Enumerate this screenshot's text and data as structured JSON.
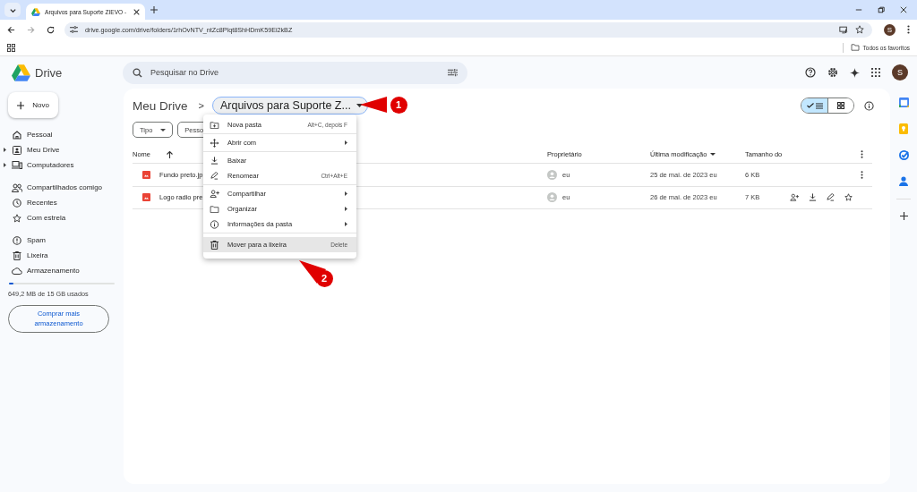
{
  "browser": {
    "tab_title": "Arquivos para Suporte ZIEVO -",
    "url": "drive.google.com/drive/folders/1rhOvNTV_ntZc8Plqt8ShHDmK59Ei2kBZ",
    "profile_initial": "S",
    "bookmarks_folder": "Todos os favoritos"
  },
  "app": {
    "logo_text": "Drive",
    "search": {
      "placeholder": "Pesquisar no Drive"
    },
    "account_initial": "S"
  },
  "new_button": "Novo",
  "sidebar": {
    "sections": [
      [
        {
          "label": "Pessoal",
          "expandable": false
        },
        {
          "label": "Meu Drive",
          "expandable": true
        },
        {
          "label": "Computadores",
          "expandable": true
        }
      ],
      [
        {
          "label": "Compartilhados comigo",
          "expandable": false
        },
        {
          "label": "Recentes",
          "expandable": false
        },
        {
          "label": "Com estrela",
          "expandable": false
        }
      ],
      [
        {
          "label": "Spam",
          "expandable": false
        },
        {
          "label": "Lixeira",
          "expandable": false
        },
        {
          "label": "Armazenamento",
          "expandable": false
        }
      ]
    ],
    "storage": {
      "level": 0.04,
      "text": "649,2 MB de 15 GB usados",
      "button": "Comprar mais armazenamento"
    }
  },
  "breadcrumb": {
    "root": "Meu Drive",
    "separator": ">",
    "current": "Arquivos para Suporte Z..."
  },
  "view_toggle": [
    {
      "selected": true
    },
    {
      "selected": false
    }
  ],
  "filters": [
    "Tipo",
    "Pesso"
  ],
  "table": {
    "columns": [
      "Nome",
      "Proprietário",
      "Última modificação",
      "Tamanho do"
    ],
    "rows": [
      {
        "name": "Fundo preto.jp",
        "owner": "eu",
        "modified": "25 de mai. de 2023 eu",
        "size": "6 KB",
        "hovered": false
      },
      {
        "name": "Logo radio pre",
        "owner": "eu",
        "modified": "26 de mai. de 2023 eu",
        "size": "7 KB",
        "hovered": true
      }
    ]
  },
  "context_menu": {
    "sections": [
      [
        {
          "label": "Nova pasta",
          "shortcut": "Alt+C, depois F",
          "submenu": false,
          "selected": false
        }
      ],
      [
        {
          "label": "Abrir com",
          "submenu": true,
          "selected": false
        }
      ],
      [
        {
          "label": "Baixar",
          "submenu": false,
          "selected": false
        },
        {
          "label": "Renomear",
          "shortcut": "Ctrl+Alt+E",
          "submenu": false,
          "selected": false
        }
      ],
      [
        {
          "label": "Compartilhar",
          "submenu": true,
          "selected": false
        },
        {
          "label": "Organizar",
          "submenu": true,
          "selected": false
        },
        {
          "label": "Informações da pasta",
          "submenu": true,
          "selected": false
        }
      ],
      [
        {
          "label": "Mover para a lixeira",
          "shortcut": "Delete",
          "submenu": false,
          "selected": true
        }
      ]
    ]
  },
  "callouts": [
    {
      "label": "1"
    },
    {
      "label": "2"
    }
  ]
}
